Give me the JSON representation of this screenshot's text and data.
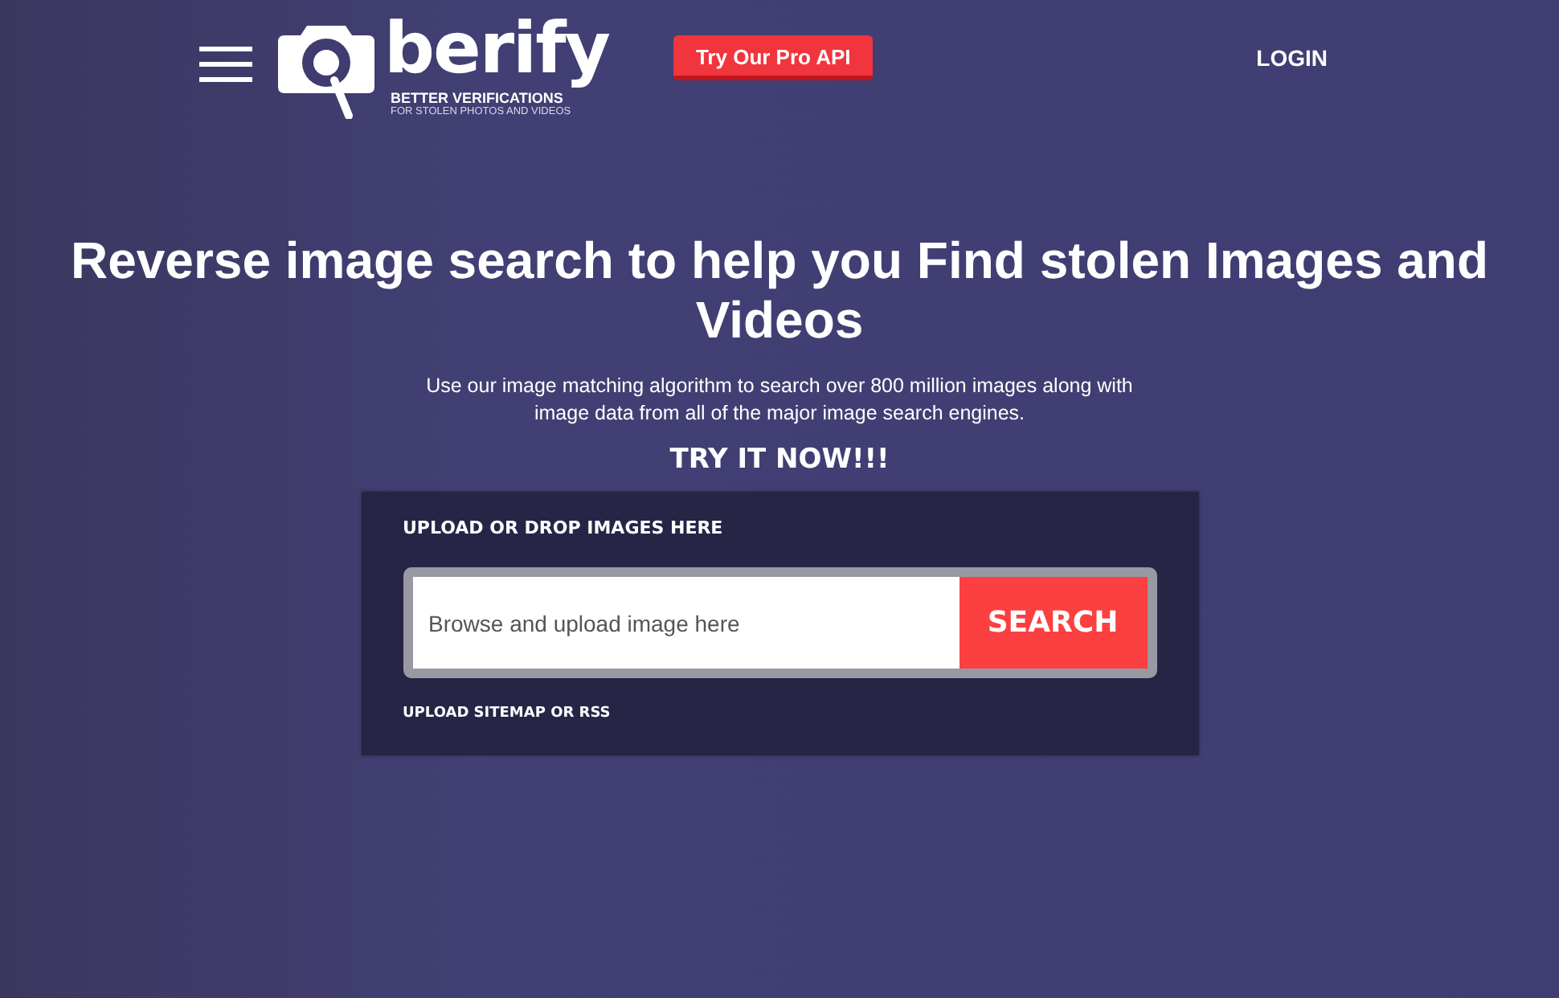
{
  "header": {
    "brand": "berify",
    "tagline": "BETTER VERIFICATIONS",
    "subtagline": "FOR STOLEN PHOTOS AND VIDEOS",
    "pro_button": "Try Our Pro API",
    "login": "LOGIN"
  },
  "hero": {
    "title": "Reverse image search to help you Find stolen Images and Videos",
    "subtitle": "Use our image matching algorithm to search over 800 million images along with image data from all of the major image search engines.",
    "cta": "TRY IT NOW!!!"
  },
  "upload": {
    "label": "UPLOAD OR DROP IMAGES HERE",
    "placeholder": "Browse and upload image here",
    "button": "SEARCH",
    "link": "UPLOAD SITEMAP OR RSS"
  }
}
